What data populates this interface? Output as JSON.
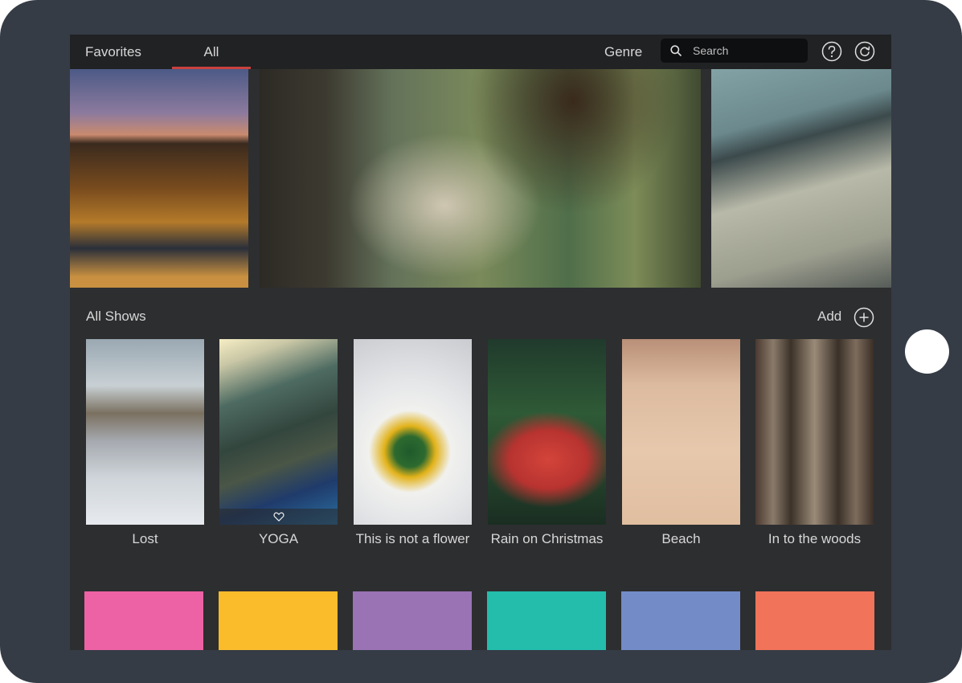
{
  "nav": {
    "tabs": [
      {
        "label": "Favorites",
        "active": false
      },
      {
        "label": "All",
        "active": true
      }
    ],
    "genre_label": "Genre",
    "search_placeholder": "Search",
    "active_tab_color": "#c9413f"
  },
  "hero": {
    "slides": [
      {
        "icon": "city-skyline-photo"
      },
      {
        "icon": "man-in-van-photo"
      },
      {
        "icon": "vintage-map-photo"
      }
    ]
  },
  "shows": {
    "title": "All Shows",
    "add_label": "Add",
    "items": [
      {
        "title": "Lost"
      },
      {
        "title": "YOGA",
        "favorite": true
      },
      {
        "title": "This is not a flower"
      },
      {
        "title": "Rain on Christmas"
      },
      {
        "title": "Beach"
      },
      {
        "title": "In to the woods"
      }
    ]
  },
  "genres": {
    "colors": [
      "#ec62a4",
      "#fbbc2c",
      "#9a73b4",
      "#24bcab",
      "#738cc8",
      "#f0735a"
    ]
  }
}
